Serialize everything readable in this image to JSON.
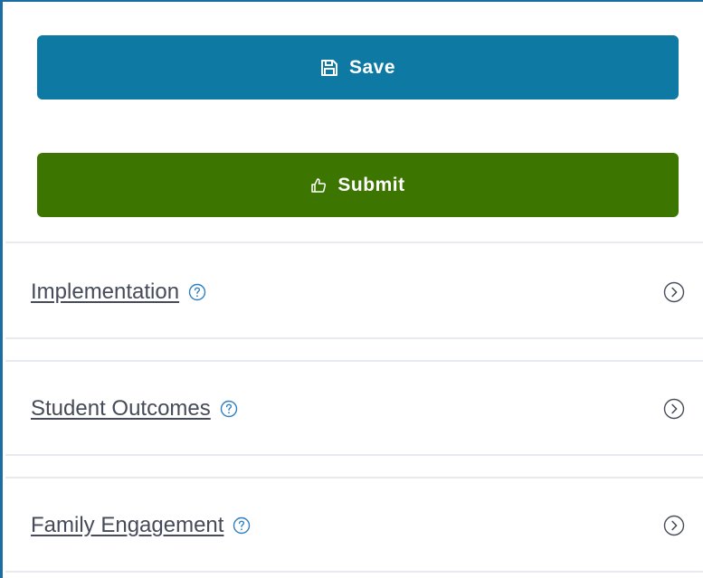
{
  "actions": {
    "save_label": "Save",
    "submit_label": "Submit"
  },
  "icons": {
    "save": "floppy-disk-icon",
    "submit": "thumbs-up-icon",
    "help": "question-circle-icon",
    "expand": "chevron-right-circle-icon"
  },
  "colors": {
    "save_button": "#0e79a2",
    "submit_button": "#3c7500",
    "link_text": "#454b58",
    "help_icon": "#2f7fc1",
    "frame_border": "#1b6ea3"
  },
  "sections": [
    {
      "label": "Implementation"
    },
    {
      "label": "Student Outcomes"
    },
    {
      "label": "Family Engagement"
    }
  ]
}
